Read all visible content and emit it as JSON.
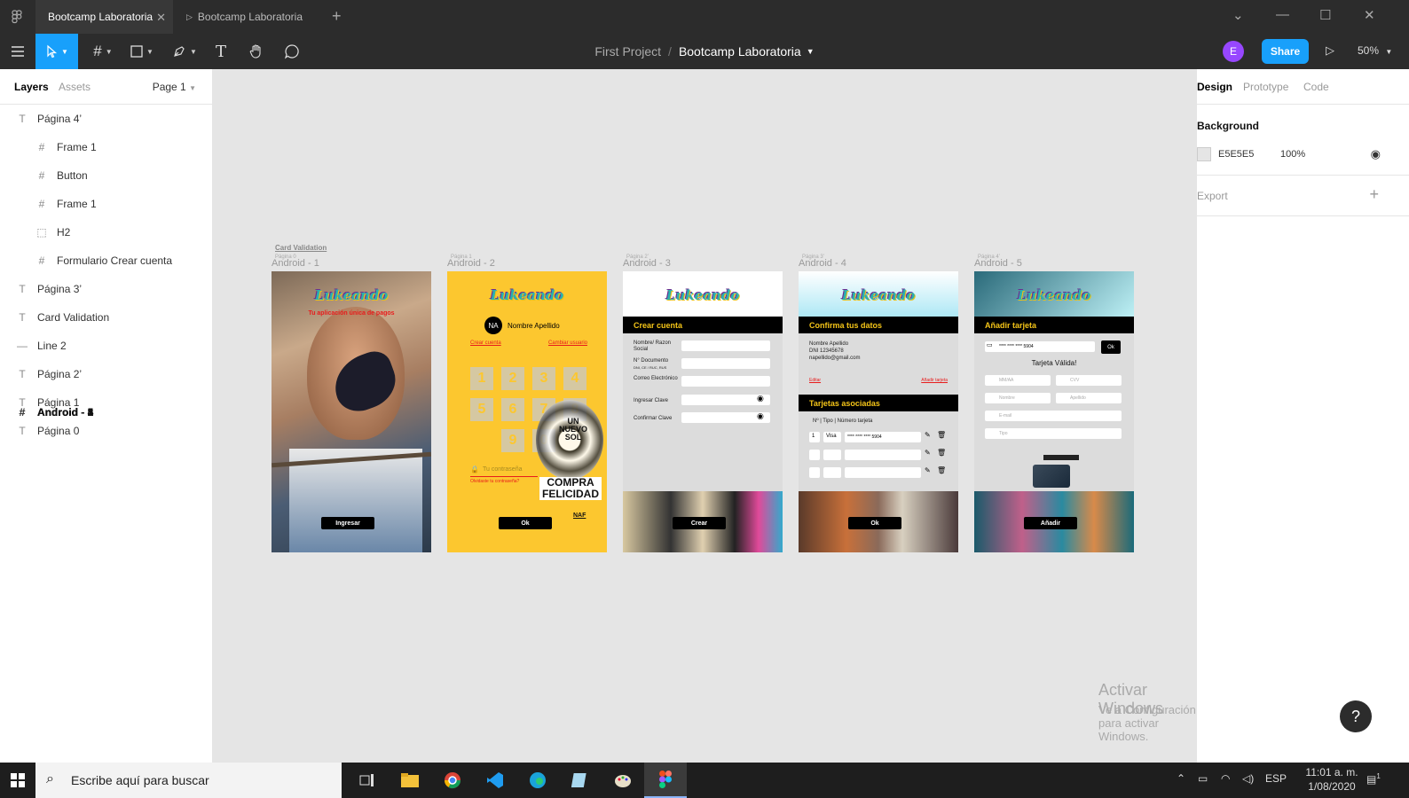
{
  "titlebar": {
    "active_tab": "Bootcamp Laboratoria",
    "inactive_tab": "Bootcamp Laboratoria"
  },
  "toolbar": {
    "project": "First Project",
    "separator": "/",
    "file": "Bootcamp Laboratoria",
    "avatar_initial": "E",
    "share_label": "Share",
    "zoom": "50%"
  },
  "left_panel": {
    "tab_layers": "Layers",
    "tab_assets": "Assets",
    "page_selector": "Page 1",
    "layers": [
      {
        "name": "Página 4’",
        "type": "text"
      },
      {
        "name": "Android - 5",
        "type": "frame"
      },
      {
        "name": "Frame 1",
        "type": "child-frame"
      },
      {
        "name": "Button",
        "type": "child-frame"
      },
      {
        "name": "Frame 1",
        "type": "child-frame"
      },
      {
        "name": "H2",
        "type": "child-group"
      },
      {
        "name": "Formulario Crear cuenta",
        "type": "child-frame"
      },
      {
        "name": "Página 3’",
        "type": "text"
      },
      {
        "name": "Android - 4",
        "type": "frame"
      },
      {
        "name": "Card Validation",
        "type": "text"
      },
      {
        "name": "Line 2",
        "type": "line"
      },
      {
        "name": "Página 2’",
        "type": "text"
      },
      {
        "name": "Android - 3",
        "type": "frame"
      },
      {
        "name": "Página 1",
        "type": "text"
      },
      {
        "name": "Android - 2",
        "type": "frame"
      },
      {
        "name": "Página 0",
        "type": "text"
      },
      {
        "name": "Android - 1",
        "type": "frame"
      }
    ]
  },
  "right_panel": {
    "tab_design": "Design",
    "tab_prototype": "Prototype",
    "tab_code": "Code",
    "background_title": "Background",
    "background_hex": "E5E5E5",
    "background_opacity": "100%",
    "export_title": "Export"
  },
  "canvas": {
    "card_validation_label": "Card Validation",
    "frames": [
      {
        "label": "Android - 1",
        "sub": "Página 0"
      },
      {
        "label": "Android - 2",
        "sub": "Página 1"
      },
      {
        "label": "Android - 3",
        "sub": "Página 2’"
      },
      {
        "label": "Android - 4",
        "sub": "Página 3’"
      },
      {
        "label": "Android - 5",
        "sub": "Página 4’"
      }
    ],
    "logo": "Lukeando",
    "f1": {
      "line1": "Tu aplicación única de pagos",
      "button": "Ingresar"
    },
    "f2": {
      "initials": "NA",
      "name": "Nombre Apellido",
      "link_left": "Crear cuenta",
      "link_right": "Cambiar usuario",
      "digits": [
        "1",
        "2",
        "3",
        "4",
        "5",
        "6",
        "7",
        "8",
        "9",
        "0"
      ],
      "password_placeholder": "Tu contraseña",
      "forgot": "Olvidaste tu contraseña?",
      "button": "Ok",
      "poster_text": "COMPRA FELICIDAD",
      "poster_badge": "UN NUEVO SOL",
      "poster_naf": "NAF"
    },
    "f3": {
      "bar": "Crear cuenta",
      "fields": [
        "Nombre/ Razon Social",
        "N° Documento",
        "Correo Electrónico",
        "Ingresar Clave",
        "Confirmar Clave"
      ],
      "doc_hint": "DNI, CE / RUC, RUS",
      "button": "Crear"
    },
    "f4": {
      "bar": "Confirma tus datos",
      "info": [
        "Nombre Apellido",
        "DNI 12345678",
        "napellido@gmail.com"
      ],
      "link_left": "Editar",
      "link_right": "Añadir tarjeta",
      "bar2": "Tarjetas asociadas",
      "table_header": "Nº  |  Tipo  |  Número tarjeta",
      "row_num": "1",
      "row_type": "Visa",
      "row_card": "**** **** **** 5904",
      "button": "Ok"
    },
    "f5": {
      "bar": "Añadir tarjeta",
      "card_number": "**** **** **** 5904",
      "ok": "Ok",
      "valid": "Tarjeta Válida!",
      "mmaa": "MM/AA",
      "cvv": "CVV",
      "nombre": "Nombre",
      "apellido": "Apellido",
      "email": "E-mail",
      "tipo": "Tipo",
      "button": "Añadir"
    }
  },
  "watermark": {
    "line1": "Activar Windows",
    "line2": "Ve a Configuración para activar Windows."
  },
  "help_label": "?",
  "taskbar": {
    "search_placeholder": "Escribe aquí para buscar",
    "lang": "ESP",
    "time": "11:01 a. m.",
    "date": "1/08/2020",
    "notif_count": "1"
  }
}
